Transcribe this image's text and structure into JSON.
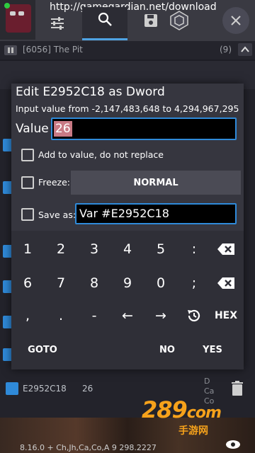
{
  "top_bar": {
    "url": "http://gamegardian.net/download"
  },
  "process": {
    "name": "[6056] The Pit",
    "count": "(9)"
  },
  "background": {
    "result_address": "E2952C18",
    "result_value": "26",
    "result_types": [
      "D",
      "Ca",
      "Co"
    ],
    "bottom_line": "8.16.0 + Ch,Jh,Ca,Co,A  9  298.2227"
  },
  "watermark": {
    "logo": "289",
    "logo_suffix": "com",
    "sub": "手游网"
  },
  "dialog": {
    "title": "Edit E2952C18 as Dword",
    "range": "Input value from -2,147,483,648 to 4,294,967,295",
    "value_label": "Value",
    "value": "26",
    "add_label": "Add to value, do not replace",
    "freeze_label": "Freeze:",
    "freeze_mode": "NORMAL",
    "save_label": "Save as:",
    "save_value": "Var #E2952C18"
  },
  "keypad": {
    "row1": [
      "1",
      "2",
      "3",
      "4",
      "5",
      ":"
    ],
    "row2": [
      "6",
      "7",
      "8",
      "9",
      "0",
      ";"
    ],
    "row3": [
      ",",
      ".",
      "-",
      "←",
      "→"
    ],
    "hex": "HEX",
    "goto": "GOTO",
    "no": "NO",
    "yes": "YES"
  },
  "colors": {
    "accent": "#2f8ad9",
    "dialog_bg": "#36363f",
    "keypad_bg": "#2f2f37",
    "selection": "#c97a85",
    "watermark": "#f6a21b"
  },
  "icons": [
    "sliders-icon",
    "search-icon",
    "save-icon",
    "game-logo-icon",
    "close-icon",
    "pause-icon",
    "backspace-icon",
    "history-icon",
    "eye-icon",
    "trash-icon"
  ]
}
